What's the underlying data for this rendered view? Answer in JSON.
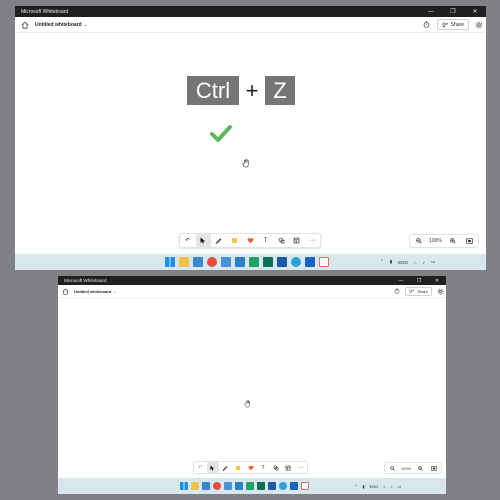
{
  "windows": [
    {
      "title": "Microsoft Whiteboard",
      "board_name": "Untitled whiteboard",
      "share_label": "Share",
      "zoom": "100%",
      "content": {
        "keys": [
          "Ctrl",
          "Z"
        ],
        "plus": "+",
        "check_color": "#5cb85c"
      },
      "tray_language": "ENG"
    },
    {
      "title": "Microsoft Whiteboard",
      "board_name": "Untitled whiteboard",
      "share_label": "Share",
      "zoom": "100%",
      "tray_language": "ENG"
    }
  ],
  "toolbar_tools": [
    "undo-icon",
    "select-icon",
    "pen-icon",
    "sticky-note-icon",
    "reaction-heart-icon",
    "text-icon",
    "shapes-icon",
    "templates-icon",
    "more-icon"
  ],
  "taskbar_apps": [
    "start",
    "search",
    "file-explorer",
    "photos",
    "chrome",
    "notepad",
    "excel",
    "onedrive",
    "word",
    "linkedin",
    "edge",
    "mail",
    "whiteboard"
  ],
  "colors": {
    "titlebar": "#202020",
    "desktop": "#808184",
    "taskbar": "#d8e6ee",
    "keycap": "#757575",
    "accent_blue": "#1a73e8"
  }
}
